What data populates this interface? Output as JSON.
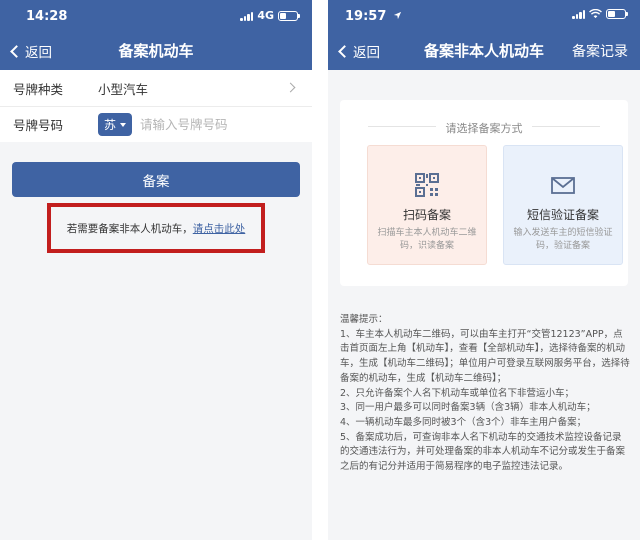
{
  "left": {
    "status": {
      "time": "14:28",
      "network": "4G"
    },
    "nav": {
      "back": "返回",
      "title": "备案机动车"
    },
    "form": {
      "plate_type_label": "号牌种类",
      "plate_type_value": "小型汽车",
      "plate_number_label": "号牌号码",
      "province": "苏",
      "plate_placeholder": "请输入号牌号码"
    },
    "submit_label": "备案",
    "notice_text": "若需要备案非本人机动车，",
    "notice_link": "请点击此处"
  },
  "right": {
    "status": {
      "time": "19:57"
    },
    "nav": {
      "back": "返回",
      "title": "备案非本人机动车",
      "action": "备案记录"
    },
    "card": {
      "title": "请选择备案方式",
      "scan": {
        "title": "扫码备案",
        "desc": "扫描车主本人机动车二维码，识读备案"
      },
      "sms": {
        "title": "短信验证备案",
        "desc": "输入发送车主的短信验证码，验证备案"
      }
    },
    "tips": {
      "heading": "温馨提示：",
      "items": [
        "1、车主本人机动车二维码，可以由车主打开“交管12123”APP，点击首页面左上角【机动车】，查看【全部机动车】，选择待备案的机动车，生成【机动车二维码】；单位用户可登录互联网服务平台，选择待备案的机动车，生成【机动车二维码】；",
        "2、只允许备案个人名下机动车或单位名下非营运小车；",
        "3、同一用户最多可以同时备案3辆（含3辆）非本人机动车；",
        "4、一辆机动车最多同时被3个（含3个）非车主用户备案；",
        "5、备案成功后，可查询非本人名下机动车的交通技术监控设备记录的交通违法行为，并可处理备案的非本人机动车不记分或发生于备案之后的有记分并适用于简易程序的电子监控违法记录。"
      ]
    }
  },
  "colors": {
    "brand": "#3f63a3",
    "highlight": "#c21e1e"
  }
}
